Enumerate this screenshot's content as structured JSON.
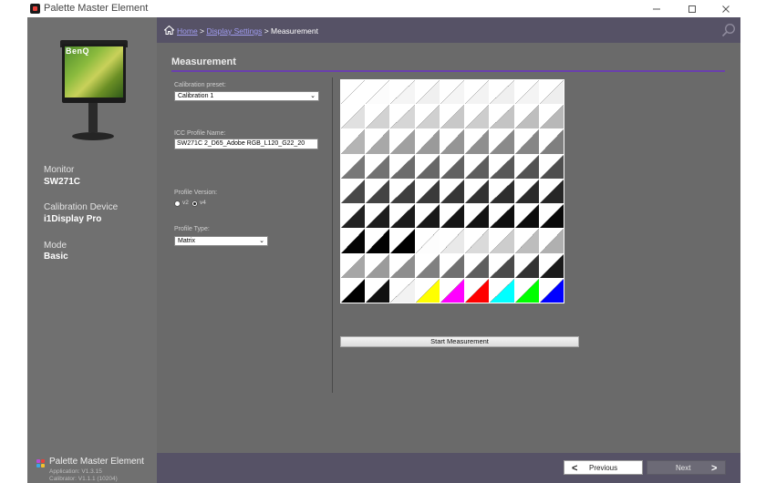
{
  "window": {
    "title": "Palette Master Element",
    "minimize_icon": "minimize-icon",
    "maximize_icon": "maximize-icon",
    "close_icon": "close-icon"
  },
  "sidebar": {
    "monitor_brand": "BenQ",
    "monitor_label": "Monitor",
    "monitor_value": "SW271C",
    "device_label": "Calibration Device",
    "device_value": "i1Display Pro",
    "mode_label": "Mode",
    "mode_value": "Basic",
    "footer_title": "Palette Master Element",
    "application_version": "Application: V1.3.15",
    "calibrator_version": "Calibrator: V1.1.1 (10204)"
  },
  "breadcrumb": {
    "home": "Home",
    "separator": " > ",
    "display_settings": "Display Settings",
    "current": "Measurement"
  },
  "section": {
    "title": "Measurement"
  },
  "form": {
    "calibration_preset_label": "Calibration preset:",
    "calibration_preset_value": "Calibration 1",
    "icc_profile_label": "ICC Profile Name:",
    "icc_profile_value": "SW271C 2_D65_Adobe RGB_L120_G22_20",
    "profile_version_label": "Profile Version:",
    "profile_version_options": [
      "v2",
      "v4"
    ],
    "profile_version_selected": "v4",
    "profile_type_label": "Profile Type:",
    "profile_type_value": "Matrix"
  },
  "patch_colors": [
    [
      "#ffffff",
      "#fcfcfc",
      "#f5f5f5",
      "#f0f0f0",
      "#f5f5f5",
      "#f3f3f3",
      "#f0f0f0",
      "#f4f4f4",
      "#eeeeee"
    ],
    [
      "#e0e0e0",
      "#d2d2d2",
      "#d6d6d6",
      "#d0d0d0",
      "#c8c8c8",
      "#cdcdcd",
      "#c4c4c4",
      "#bebebe",
      "#b8b8b8"
    ],
    [
      "#b4b4b4",
      "#a8a8a8",
      "#a0a0a0",
      "#9a9a9a",
      "#959595",
      "#8f8f8f",
      "#8a8a8a",
      "#868686",
      "#7f7f7f"
    ],
    [
      "#787878",
      "#727272",
      "#6c6c6c",
      "#676767",
      "#626262",
      "#5d5d5d",
      "#585858",
      "#535353",
      "#4e4e4e"
    ],
    [
      "#484848",
      "#434343",
      "#3e3e3e",
      "#3a3a3a",
      "#363636",
      "#323232",
      "#2e2e2e",
      "#2a2a2a",
      "#262626"
    ],
    [
      "#222222",
      "#1e1e1e",
      "#1b1b1b",
      "#181818",
      "#151515",
      "#121212",
      "#0f0f0f",
      "#0c0c0c",
      "#090909"
    ],
    [
      "#050505",
      "#020202",
      "#000000",
      "#fdfdfd",
      "#e9e9e9",
      "#dadada",
      "#cdcdcd",
      "#bdbdbd",
      "#b0b0b0"
    ],
    [
      "#a6a6a6",
      "#9b9b9b",
      "#8e8e8e",
      "#808080",
      "#707070",
      "#5e5e5e",
      "#4a4a4a",
      "#333333",
      "#1a1a1a"
    ],
    [
      "#000000",
      "#111111",
      "#f2f2f2",
      "#ffff00",
      "#ff00ff",
      "#ff0000",
      "#00ffff",
      "#00ff00",
      "#0000ff"
    ]
  ],
  "actions": {
    "start_measurement": "Start Measurement",
    "previous": "Previous",
    "next": "Next"
  },
  "icons": {
    "home": "home-icon",
    "search": "search-icon",
    "dropdown": "chevron-down-icon",
    "previous": "chevron-left-icon",
    "next": "chevron-right-icon"
  },
  "colors": {
    "sidebar_bg": "#707070",
    "main_bg": "#6a6a6a",
    "header_bg": "#565266",
    "accent_rule": "#6a3fae",
    "link": "#a09cf0"
  }
}
